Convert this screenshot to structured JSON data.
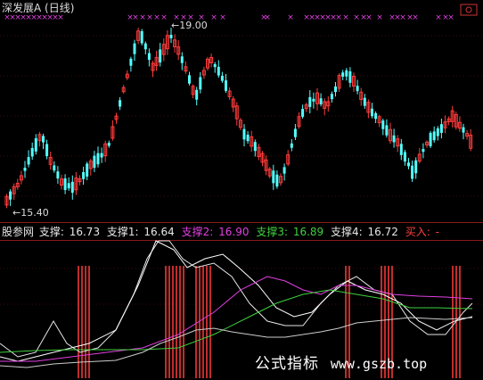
{
  "window": {
    "title": "深发展A (日线)"
  },
  "main_chart": {
    "high_label": "19.00",
    "low_label": "15.40"
  },
  "indicator": {
    "name": "股参网",
    "support": {
      "label": "支撑:",
      "value": "16.73",
      "color": "#e6e6e6"
    },
    "support1": {
      "label": "支撑1:",
      "value": "16.64",
      "color": "#e6e6e6"
    },
    "support2": {
      "label": "支撑2:",
      "value": "16.90",
      "color": "#e040e0"
    },
    "support3": {
      "label": "支撑3:",
      "value": "16.89",
      "color": "#40d040"
    },
    "support4": {
      "label": "支撑4:",
      "value": "16.72",
      "color": "#e6e6e6"
    },
    "buy": {
      "label": "买入:",
      "value": "-",
      "color": "#ff4040"
    }
  },
  "watermark": {
    "text": "公式指标",
    "url": "www.gszb.top"
  },
  "colors": {
    "up": "#ff3c3c",
    "down": "#54ffff",
    "marker": "#e040e0",
    "axis": "#8b1a1a"
  },
  "icons": {
    "menu": "menu-icon",
    "low_arrow": "left-arrow-icon",
    "high_arrow": "left-arrow-icon"
  }
}
